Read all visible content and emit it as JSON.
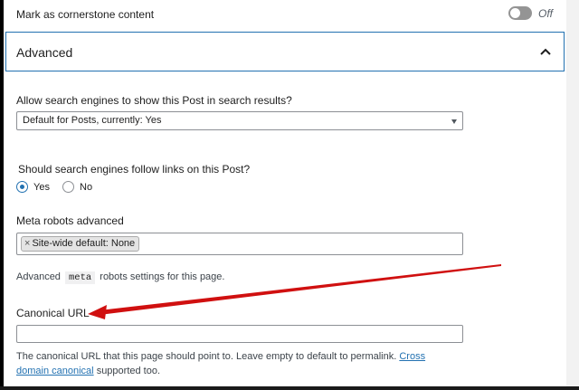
{
  "cornerstone": {
    "label": "Mark as cornerstone content",
    "toggle_state": "Off"
  },
  "advanced": {
    "title": "Advanced",
    "icon": "chevron-up-icon"
  },
  "search_results": {
    "question": "Allow search engines to show this Post in search results?",
    "selected": "Default for Posts, currently: Yes"
  },
  "follow_links": {
    "question": "Should search engines follow links on this Post?",
    "options": [
      {
        "label": "Yes",
        "selected": true
      },
      {
        "label": "No",
        "selected": false
      }
    ]
  },
  "meta_robots": {
    "label": "Meta robots advanced",
    "token": "Site-wide default: None",
    "token_remove": "×",
    "help_prefix": "Advanced",
    "help_code": "meta",
    "help_suffix": "robots settings for this page."
  },
  "canonical": {
    "label": "Canonical URL",
    "value": "",
    "help_line1_text": "The canonical URL that this page should point to. Leave empty to default to permalink.",
    "help_link_part1": "Cross",
    "help_link_part2": "domain canonical",
    "help_line2_suffix": "supported too."
  },
  "colors": {
    "accent": "#2271b1",
    "annotation_arrow": "#d01010",
    "toggle_off": "#949494"
  }
}
